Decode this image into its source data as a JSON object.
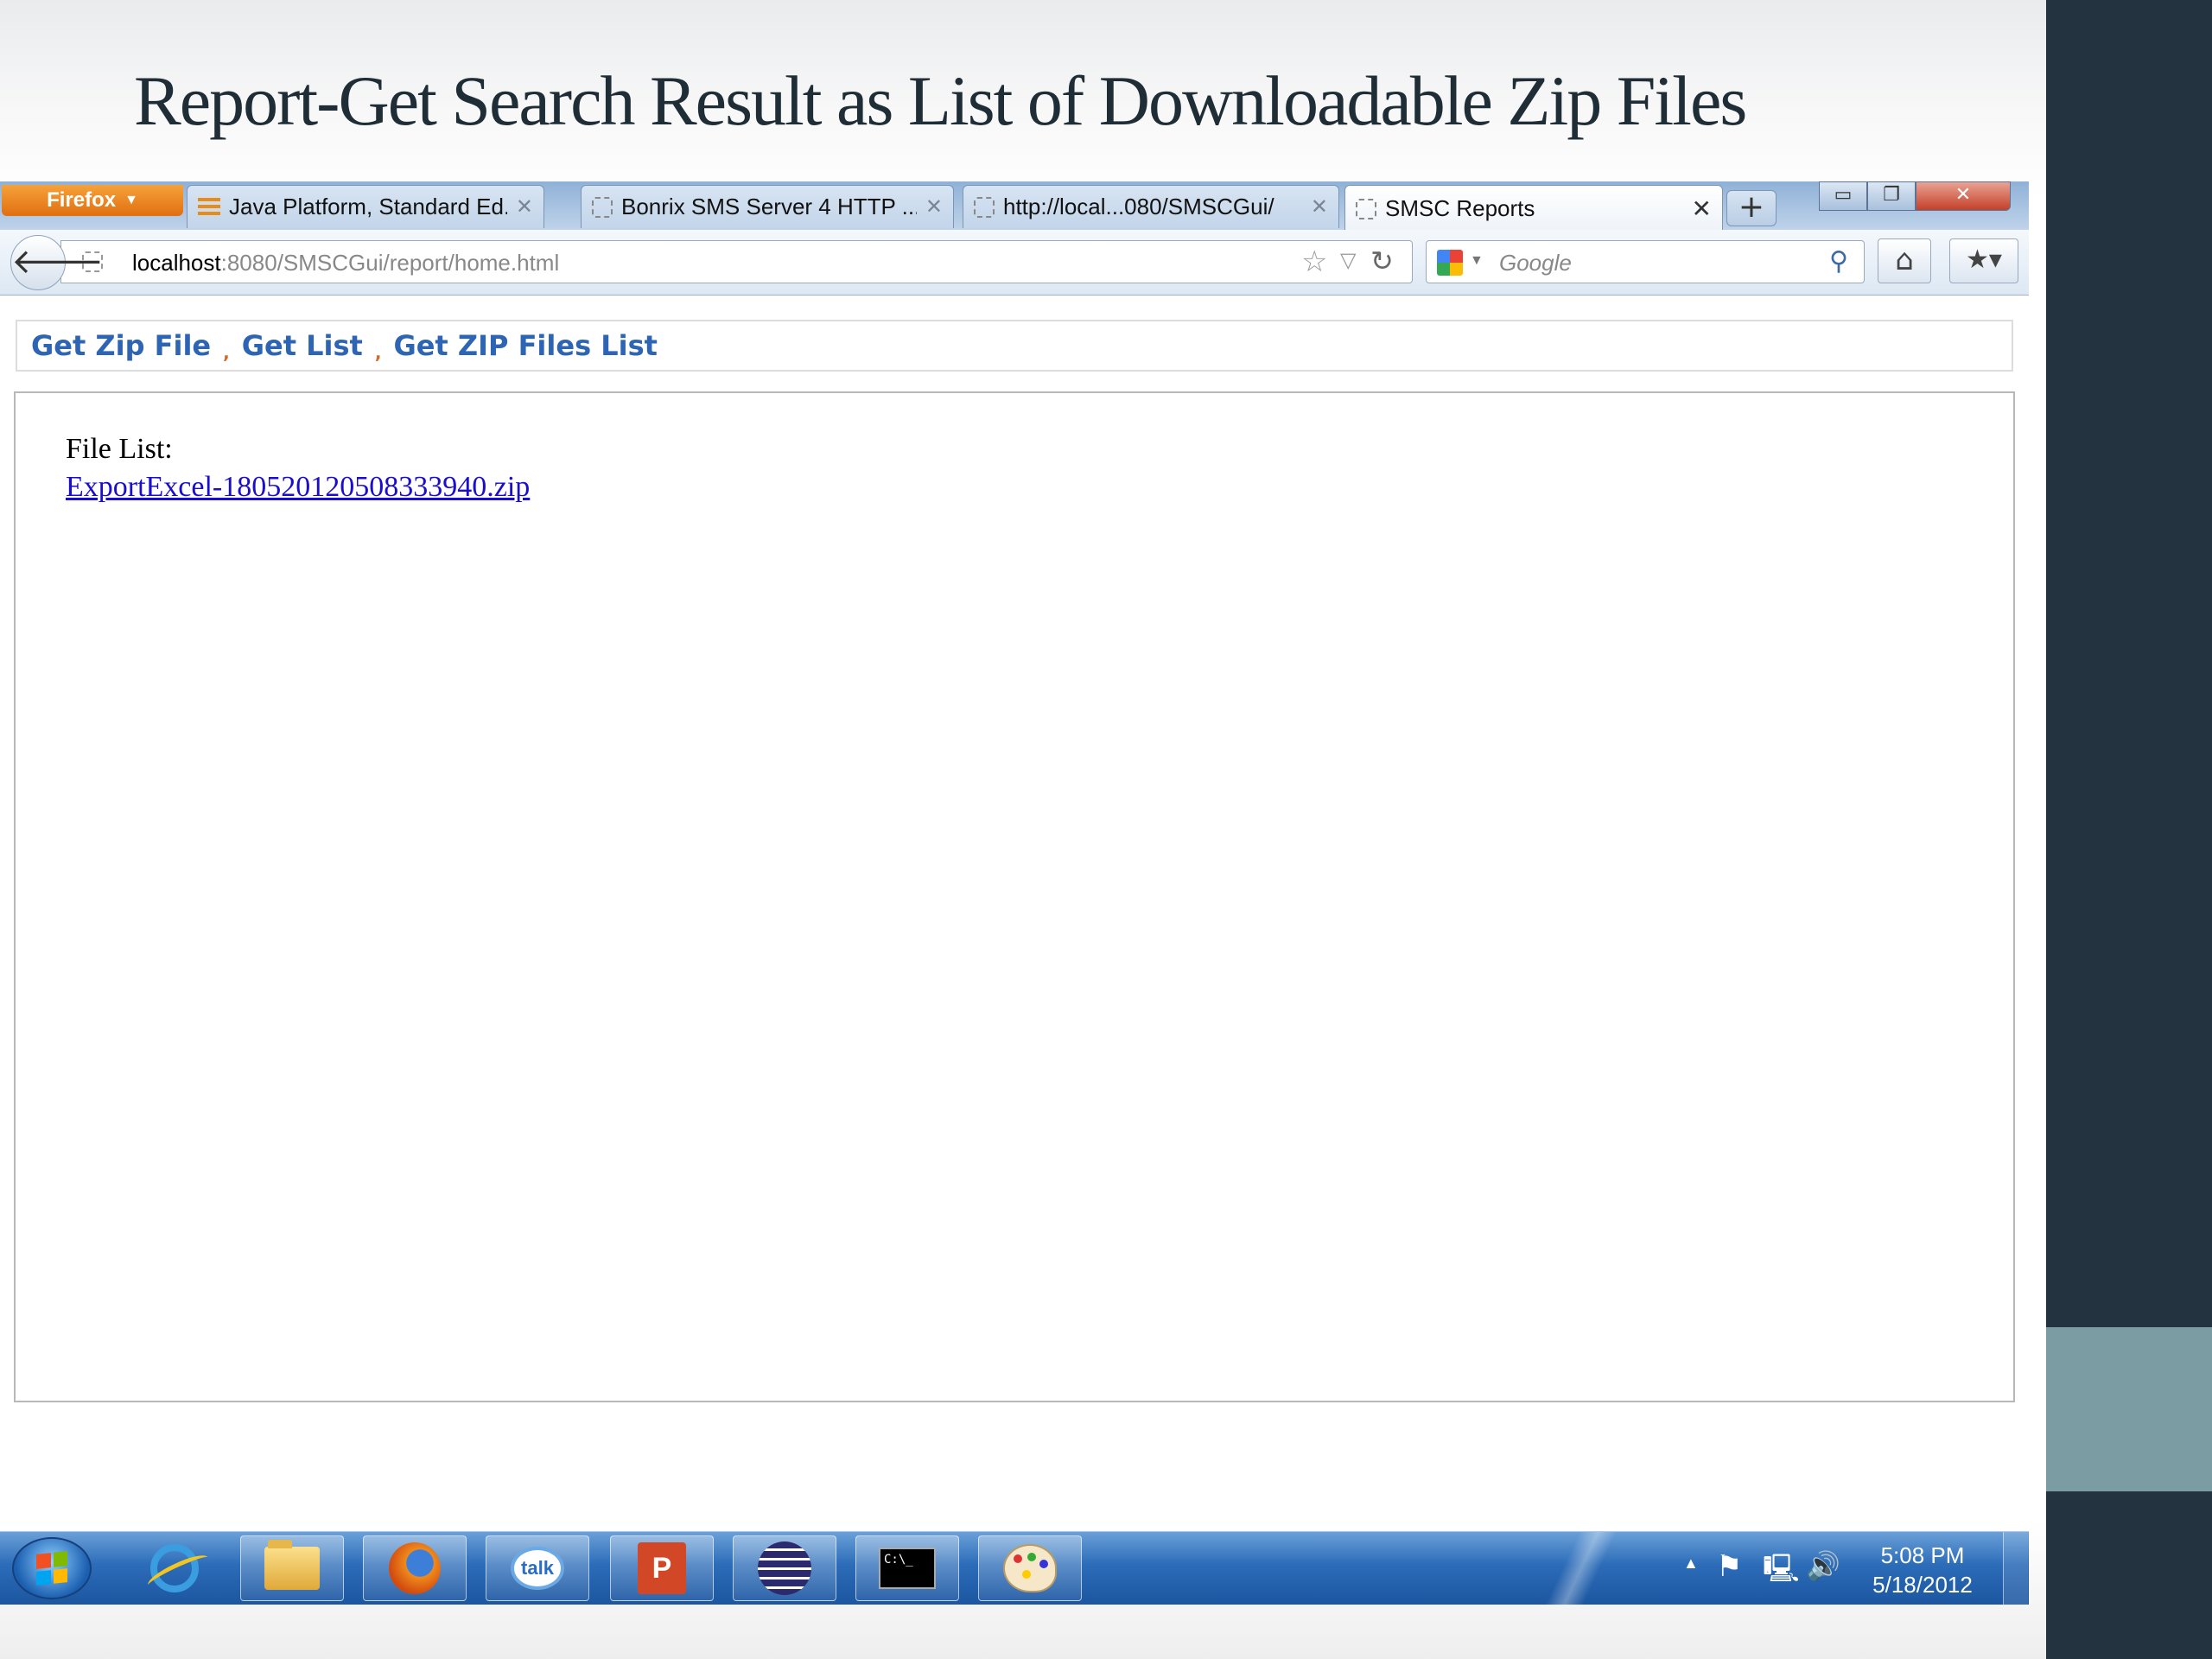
{
  "slide": {
    "title": "Report-Get Search Result as List of Downloadable Zip Files"
  },
  "browser": {
    "app_button": "Firefox",
    "tabs": [
      {
        "label": "Java Platform, Standard Ed...",
        "icon": "java-icon"
      },
      {
        "label": "Bonrix SMS Server 4 HTTP ...",
        "icon": "page-icon"
      },
      {
        "label": "http://local...080/SMSCGui/",
        "icon": "page-icon"
      },
      {
        "label": "SMSC Reports",
        "icon": "page-icon",
        "active": true
      }
    ],
    "address": {
      "host": "localhost",
      "path": ":8080/SMSCGui/report/home.html"
    },
    "search": {
      "placeholder": "Google"
    }
  },
  "page": {
    "menu": [
      {
        "label": "Get Zip File"
      },
      {
        "label": "Get List"
      },
      {
        "label": "Get ZIP Files List"
      }
    ],
    "separator": ",",
    "file_list_label": "File List:",
    "files": [
      "ExportExcel-180520120508333940.zip"
    ]
  },
  "taskbar": {
    "apps": [
      "internet-explorer",
      "windows-explorer",
      "firefox",
      "google-talk",
      "powerpoint",
      "eclipse",
      "command-prompt",
      "paint"
    ],
    "ppt_letter": "P",
    "talk_label": "talk",
    "cmd_label": "C:\\_",
    "clock": {
      "time": "5:08 PM",
      "date": "5/18/2012"
    }
  },
  "colors": {
    "link": "#2e64b4",
    "file_link": "#1a0dcc",
    "firefox_orange": "#e06f10",
    "side_dark": "#233440",
    "side_teal": "#7c9ca4"
  }
}
